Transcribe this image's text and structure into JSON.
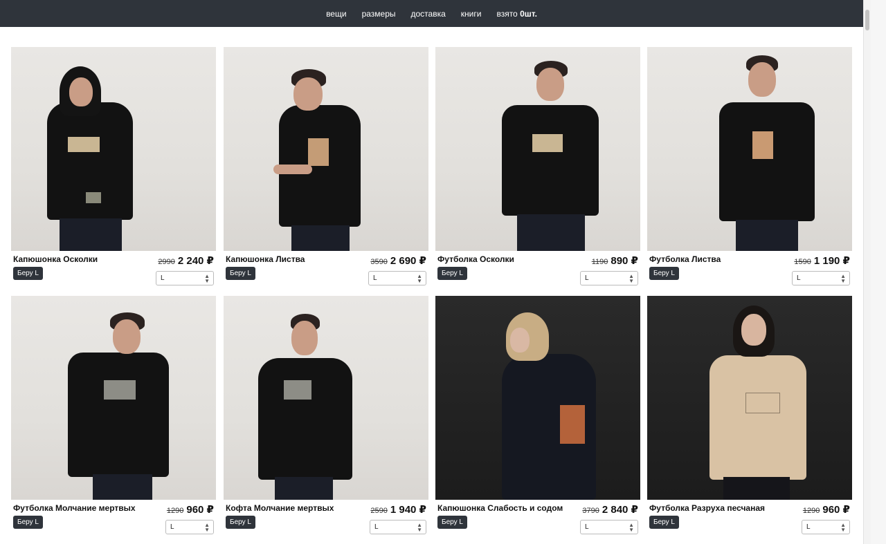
{
  "nav": {
    "items": [
      "вещи",
      "размеры",
      "доставка",
      "книги"
    ],
    "taken_label": "взято",
    "taken_count": "0шт."
  },
  "products": [
    {
      "title": "Капюшонка Осколки",
      "old_price": "2990",
      "price": "2 240 ₽",
      "button": "Беру L",
      "size": "L"
    },
    {
      "title": "Капюшонка Листва",
      "old_price": "3590",
      "price": "2 690 ₽",
      "button": "Беру L",
      "size": "L"
    },
    {
      "title": "Футболка Осколки",
      "old_price": "1190",
      "price": "890 ₽",
      "button": "Беру L",
      "size": "L"
    },
    {
      "title": "Футболка Листва",
      "old_price": "1590",
      "price": "1 190 ₽",
      "button": "Беру L",
      "size": "L"
    },
    {
      "title": "Футболка Молчание мертвых",
      "old_price": "1290",
      "price": "960 ₽",
      "button": "Беру L",
      "size": "L"
    },
    {
      "title": "Кофта Молчание мертвых",
      "old_price": "2590",
      "price": "1 940 ₽",
      "button": "Беру L",
      "size": "L"
    },
    {
      "title": "Капюшонка Слабость и содом",
      "old_price": "3790",
      "price": "2 840 ₽",
      "button": "Беру L",
      "size": "L"
    },
    {
      "title": "Футболка Разруха песчаная",
      "old_price": "1290",
      "price": "960 ₽",
      "button": "Беру L",
      "size": "L"
    }
  ]
}
